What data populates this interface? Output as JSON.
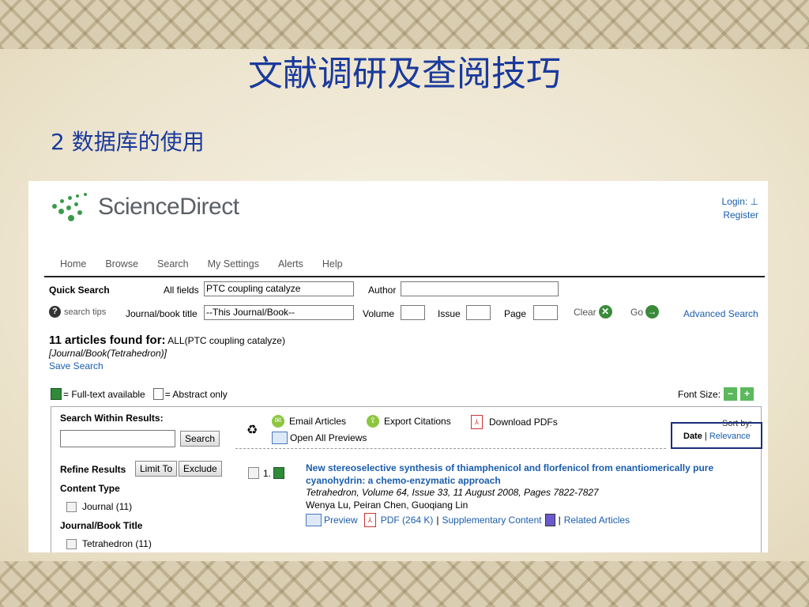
{
  "slide": {
    "title": "文献调研及查阅技巧",
    "subtitle": "2  数据库的使用"
  },
  "site": {
    "logo_text": "ScienceDirect",
    "login": "Login:",
    "register": "Register"
  },
  "nav": [
    "Home",
    "Browse",
    "Search",
    "My Settings",
    "Alerts",
    "Help"
  ],
  "quick_search": {
    "label": "Quick Search",
    "all_fields_label": "All fields",
    "all_fields_value": "PTC coupling catalyze",
    "author_label": "Author",
    "author_value": "",
    "search_tips": "search tips",
    "journal_label": "Journal/book title",
    "journal_value": "--This Journal/Book--",
    "volume_label": "Volume",
    "issue_label": "Issue",
    "page_label": "Page",
    "clear_label": "Clear",
    "go_label": "Go",
    "advanced_search": "Advanced Search"
  },
  "results_summary": {
    "count_text": "11 articles found for:",
    "query": "ALL(PTC coupling catalyze)",
    "scope": "[Journal/Book(Tetrahedron)]",
    "save_search": "Save Search"
  },
  "legend": {
    "full_text": "= Full-text available",
    "abstract_only": "= Abstract only",
    "font_size": "Font Size:"
  },
  "search_within": {
    "label": "Search Within Results:",
    "value": "",
    "button": "Search"
  },
  "actions": {
    "email": "Email Articles",
    "export": "Export Citations",
    "download": "Download PDFs",
    "open_previews": "Open All Previews"
  },
  "sort": {
    "label": "Sort by:",
    "date": "Date",
    "separator": "|",
    "relevance": "Relevance"
  },
  "refine": {
    "label": "Refine Results",
    "limit_to": "Limit To",
    "exclude": "Exclude",
    "content_type_label": "Content Type",
    "content_type_item": "Journal (11)",
    "journal_title_label": "Journal/Book Title",
    "journal_title_item": "Tetrahedron (11)"
  },
  "result": {
    "number": "1.",
    "title_line1": "New stereoselective synthesis of thiamphenicol and florfenicol from enantiomerically pure",
    "title_line2": "cyanohydrin: a chemo-enzymatic approach",
    "citation": "Tetrahedron, Volume 64, Issue 33, 11 August 2008, Pages 7822-7827",
    "authors": "Wenya Lu, Peiran Chen, Guoqiang Lin",
    "preview": "Preview",
    "pdf": "PDF (264 K)",
    "supplementary": "Supplementary Content",
    "related": "Related Articles",
    "sep": "|"
  },
  "colors": {
    "title_blue": "#1a3a9c",
    "link_blue": "#1a5dac",
    "logo_green": "#3a9a4a",
    "sort_box": "#1b2f7a"
  }
}
